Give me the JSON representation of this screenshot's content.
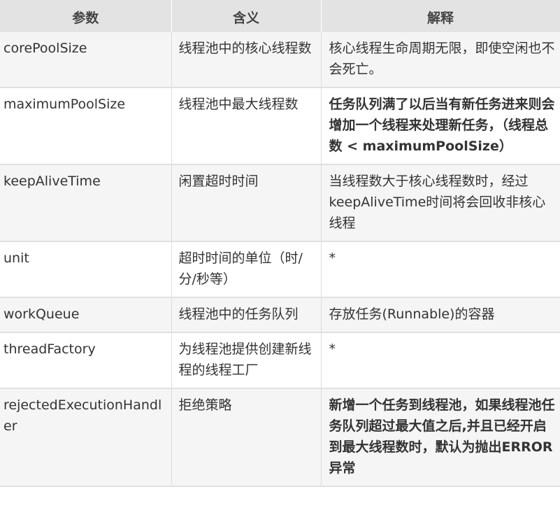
{
  "table": {
    "headers": [
      "参数",
      "含义",
      "解释"
    ],
    "rows": [
      {
        "param": "corePoolSize",
        "meaning": "线程池中的核心线程数",
        "explanation": "核心线程生命周期无限，即使空闲也不会死亡。",
        "explanation_bold": false,
        "shaded": true
      },
      {
        "param": "maximumPoolSize",
        "meaning": "线程池中最大线程数",
        "explanation": "任务队列满了以后当有新任务进来则会增加一个线程来处理新任务，（线程总数 < maximumPoolSize）",
        "explanation_bold": true,
        "shaded": false
      },
      {
        "param": "keepAliveTime",
        "meaning": "闲置超时时间",
        "explanation": "当线程数大于核心线程数时，经过keepAliveTime时间将会回收非核心线程",
        "explanation_bold": false,
        "shaded": true
      },
      {
        "param": "unit",
        "meaning": "超时时间的单位（时/分/秒等）",
        "explanation": "*",
        "explanation_bold": false,
        "shaded": false
      },
      {
        "param": "workQueue",
        "meaning": "线程池中的任务队列",
        "explanation": "存放任务(Runnable)的容器",
        "explanation_bold": false,
        "shaded": true
      },
      {
        "param": "threadFactory",
        "meaning": "为线程池提供创建新线程的线程工厂",
        "explanation": "*",
        "explanation_bold": false,
        "shaded": false
      },
      {
        "param": "rejectedExecutionHandler",
        "meaning": "拒绝策略",
        "explanation": "新增一个任务到线程池，如果线程池任务队列超过最大值之后,并且已经开启到最大线程数时，默认为抛出ERROR异常",
        "explanation_bold": true,
        "shaded": true
      }
    ]
  }
}
